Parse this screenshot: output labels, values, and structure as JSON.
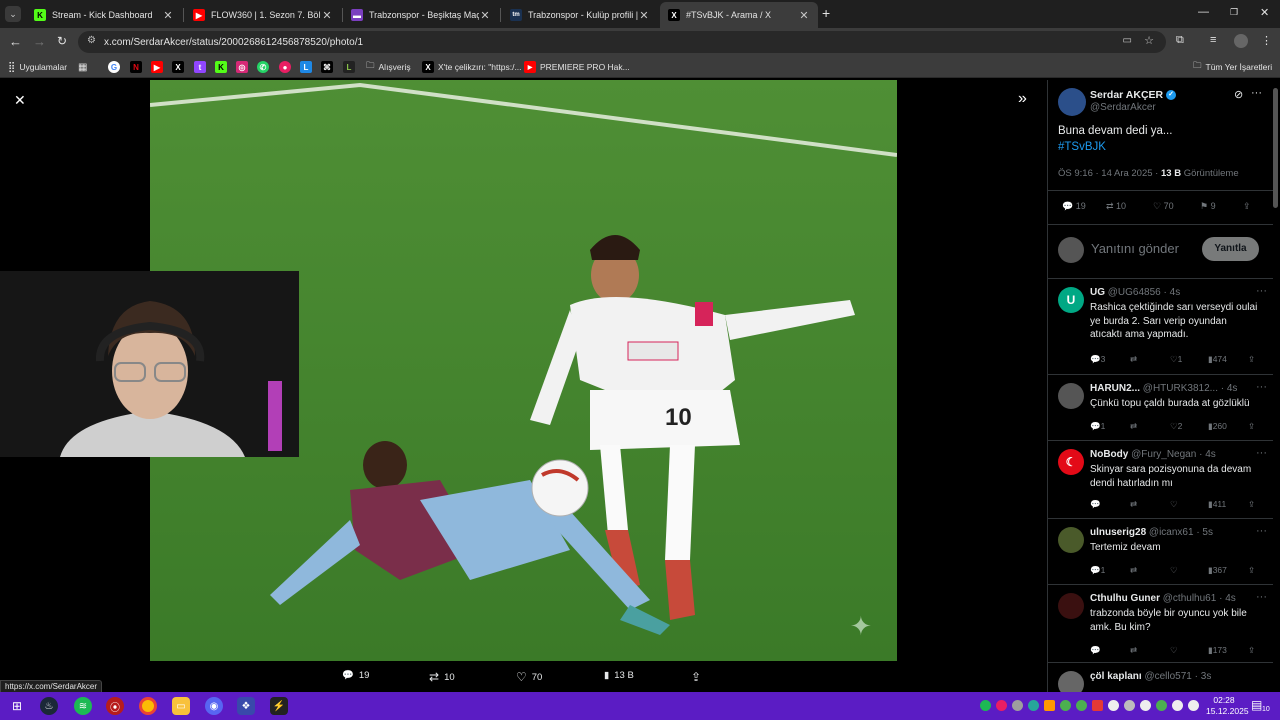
{
  "tabs": [
    {
      "title": "Stream - Kick Dashboard",
      "favicon": "K",
      "color": "#53fc18"
    },
    {
      "title": "FLOW360 | 1. Sezon 7. Bölüm |",
      "favicon": "▶",
      "color": "#ff0000"
    },
    {
      "title": "Trabzonspor - Beşiktaş Maç Öz",
      "favicon": "▬",
      "color": "#7b3fbf"
    },
    {
      "title": "Trabzonspor - Kulüp profili | Tra",
      "favicon": "tm",
      "color": "#1a3151"
    },
    {
      "title": "#TSvBJK - Arama / X",
      "favicon": "X",
      "color": "#000000"
    }
  ],
  "address": {
    "url": "x.com/SerdarAkcer/status/2000268612456878520/photo/1"
  },
  "bookmarks": {
    "apps_label": "Uygulamalar",
    "folder1": "Alışveriş",
    "x_link": "X'te çelikzırı: \"https:/...",
    "premiere": "PREMIERE PRO Hak...",
    "all_bookmarks": "Tüm Yer İşaretleri"
  },
  "photo_actions": {
    "replies": "19",
    "reposts": "10",
    "likes": "70",
    "views": "13 B"
  },
  "post": {
    "author_name": "Serdar AKÇER",
    "author_handle": "@SerdarAkcer",
    "text": "Buna devam dedi ya...",
    "hashtag": "#TSvBJK",
    "timestamp": "ÖS 9:16 · 14 Ara 2025 · ",
    "views_count": "13 B",
    "views_label": " Görüntüleme",
    "replies": "19",
    "reposts": "10",
    "likes": "70",
    "bookmarks": "9",
    "reply_placeholder": "Yanıtını gönder",
    "reply_button": "Yanıtla"
  },
  "replies": [
    {
      "name": "UG",
      "handle": "@UG64856 · 4s",
      "text": "Rashica çektiğinde sarı verseydi oulai ye burda 2. Sarı verip oyundan atıcaktı ama yapmadı.",
      "replies": "3",
      "reposts": "",
      "likes": "1",
      "views": "474",
      "avatar": "U",
      "avatar_color": "#00a884"
    },
    {
      "name": "HARUN2...",
      "handle": "@HTURK3812... · 4s",
      "text": "Çünkü topu çaldı burada at gözlüklü",
      "replies": "1",
      "reposts": "",
      "likes": "2",
      "views": "260",
      "avatar": "",
      "avatar_color": "#555555"
    },
    {
      "name": "NoBody",
      "handle": "@Fury_Negan · 4s",
      "text": "Skinyar sara pozisyonuna da devam dendi hatırladın mı",
      "replies": "",
      "reposts": "",
      "likes": "",
      "views": "411",
      "avatar": "☾",
      "avatar_color": "#e30a17"
    },
    {
      "name": "ulnuserig28",
      "handle": "@icanx61 · 5s",
      "text": "Tertemiz devam",
      "replies": "1",
      "reposts": "",
      "likes": "",
      "views": "367",
      "avatar": "",
      "avatar_color": "#4a5a2a"
    },
    {
      "name": "Cthulhu Guner",
      "handle": "@cthulhu61 · 4s",
      "text": "trabzonda böyle bir oyuncu yok bile amk. Bu kim?",
      "replies": "",
      "reposts": "",
      "likes": "",
      "views": "173",
      "avatar": "",
      "avatar_color": "#3a1010"
    },
    {
      "name": "çöl kaplanı",
      "handle": "@cello571 · 3s",
      "text": "",
      "replies": "",
      "reposts": "",
      "likes": "",
      "views": "",
      "avatar": "",
      "avatar_color": "#666666"
    }
  ],
  "status_url": "https://x.com/SerdarAkcer",
  "taskbar": {
    "time": "02:28",
    "date": "15.12.2025",
    "notif_count": "10"
  }
}
